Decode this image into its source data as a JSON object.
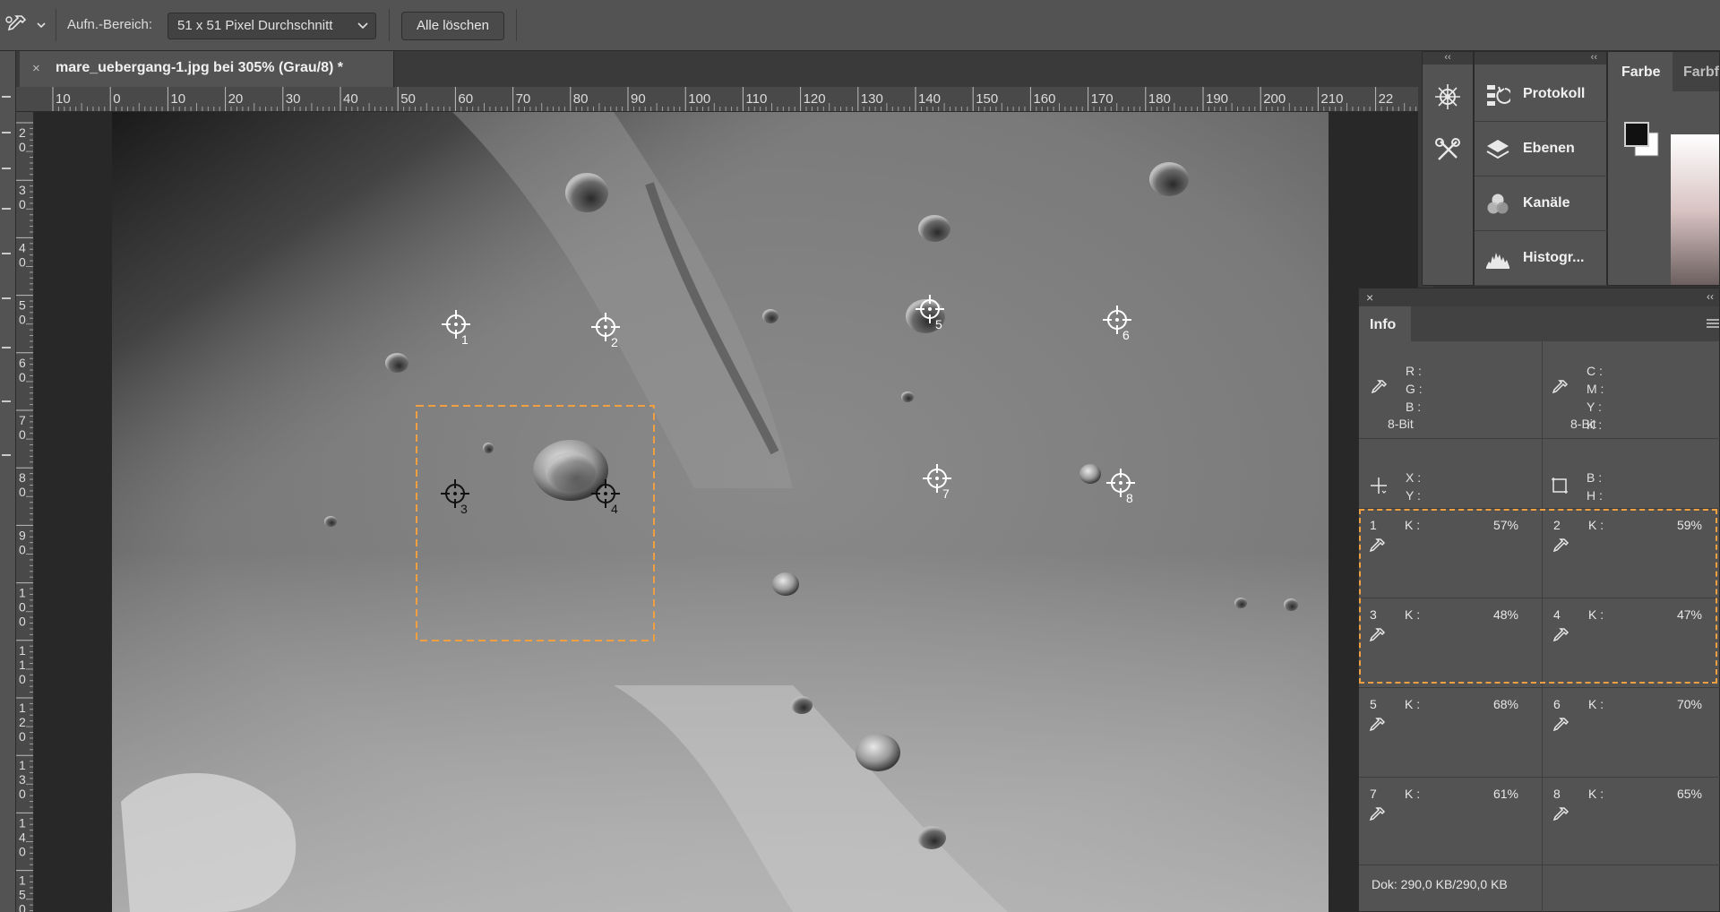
{
  "options_bar": {
    "sample_size_label": "Aufn.-Bereich:",
    "sample_size_value": "51 x 51 Pixel Durchschnitt",
    "clear_all_label": "Alle löschen",
    "tool_icon": "eyedropper-sampler-icon"
  },
  "document": {
    "tab_close": "×",
    "tab_title": "mare_uebergang-1.jpg bei 305% (Grau/8) *"
  },
  "rulers": {
    "horizontal": [
      "10",
      "0",
      "10",
      "20",
      "30",
      "40",
      "50",
      "60",
      "70",
      "80",
      "90",
      "100",
      "110",
      "120",
      "130",
      "140",
      "150",
      "160",
      "170",
      "180",
      "190",
      "200",
      "210",
      "22"
    ],
    "vertical": [
      [
        "2",
        "0"
      ],
      [
        "3",
        "0"
      ],
      [
        "4",
        "0"
      ],
      [
        "5",
        "0"
      ],
      [
        "6",
        "0"
      ],
      [
        "7",
        "0"
      ],
      [
        "8",
        "0"
      ],
      [
        "9",
        "0"
      ],
      [
        "1",
        "0",
        "0"
      ],
      [
        "1",
        "1",
        "0"
      ],
      [
        "1",
        "2",
        "0"
      ],
      [
        "1",
        "3",
        "0"
      ],
      [
        "1",
        "4",
        "0"
      ],
      [
        "1",
        "5",
        "0"
      ]
    ]
  },
  "canvas": {
    "sampler_labels": [
      "1",
      "2",
      "3",
      "4",
      "5",
      "6",
      "7",
      "8"
    ]
  },
  "panels": {
    "collapse_glyph": "‹‹",
    "items": [
      {
        "label": "Protokoll",
        "icon": "history-icon"
      },
      {
        "label": "Ebenen",
        "icon": "layers-icon"
      },
      {
        "label": "Kanäle",
        "icon": "channels-icon"
      },
      {
        "label": "Histogr...",
        "icon": "histogram-icon"
      }
    ],
    "side_icons": [
      "navigator-wheel-icon",
      "tools-icon"
    ],
    "color": {
      "tab_active": "Farbe",
      "tab_other": "Farbf",
      "foreground": "#111111",
      "background": "#ffffff"
    }
  },
  "info": {
    "close": "×",
    "collapse": "‹‹",
    "tab": "Info",
    "rgb_labels": [
      "R :",
      "G :",
      "B :"
    ],
    "rgb_bits": "8-Bit",
    "cmyk_labels": [
      "C :",
      "M :",
      "Y :",
      "K :"
    ],
    "cmyk_bits": "8-Bit",
    "xy_labels": [
      "X :",
      "Y :"
    ],
    "wh_labels": [
      "B :",
      "H :"
    ],
    "samplers": [
      {
        "num": "1",
        "k": "K :",
        "value": "57%"
      },
      {
        "num": "2",
        "k": "K :",
        "value": "59%"
      },
      {
        "num": "3",
        "k": "K :",
        "value": "48%"
      },
      {
        "num": "4",
        "k": "K :",
        "value": "47%"
      },
      {
        "num": "5",
        "k": "K :",
        "value": "68%"
      },
      {
        "num": "6",
        "k": "K :",
        "value": "70%"
      },
      {
        "num": "7",
        "k": "K :",
        "value": "61%"
      },
      {
        "num": "8",
        "k": "K :",
        "value": "65%"
      }
    ],
    "doc_size": "Dok: 290,0 KB/290,0 KB"
  },
  "colors": {
    "selection_outline": "#f0a040",
    "panel_bg": "#535353",
    "workspace_bg": "#282828"
  }
}
